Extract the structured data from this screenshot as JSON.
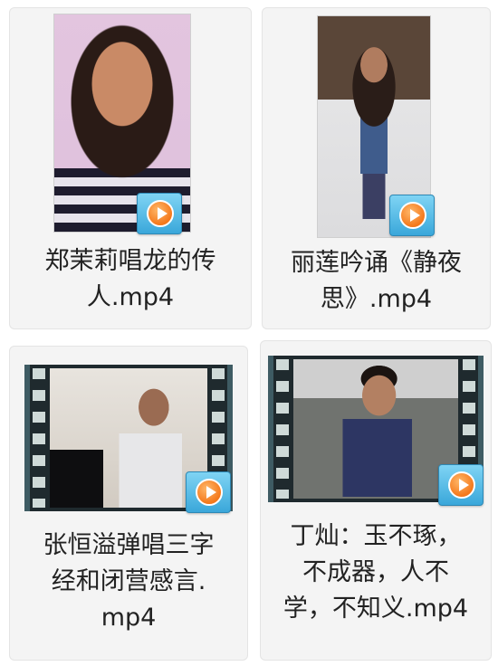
{
  "files": [
    {
      "name_lines": [
        "郑茉莉唱龙的传",
        "人.mp4"
      ]
    },
    {
      "name_lines": [
        "丽莲吟诵《静夜",
        "思》.mp4"
      ]
    },
    {
      "name_lines": [
        "张恒溢弹唱三字",
        "经和闭营感言.",
        "mp4"
      ]
    },
    {
      "name_lines": [
        "丁灿：玉不琢，",
        "不成器，人不",
        "学，不知义.mp4"
      ]
    }
  ],
  "overlay_icon": "play-icon",
  "colors": {
    "film_border": "#3e5b63",
    "badge_blue": "#3aa7da",
    "play_orange": "#f4781b"
  }
}
